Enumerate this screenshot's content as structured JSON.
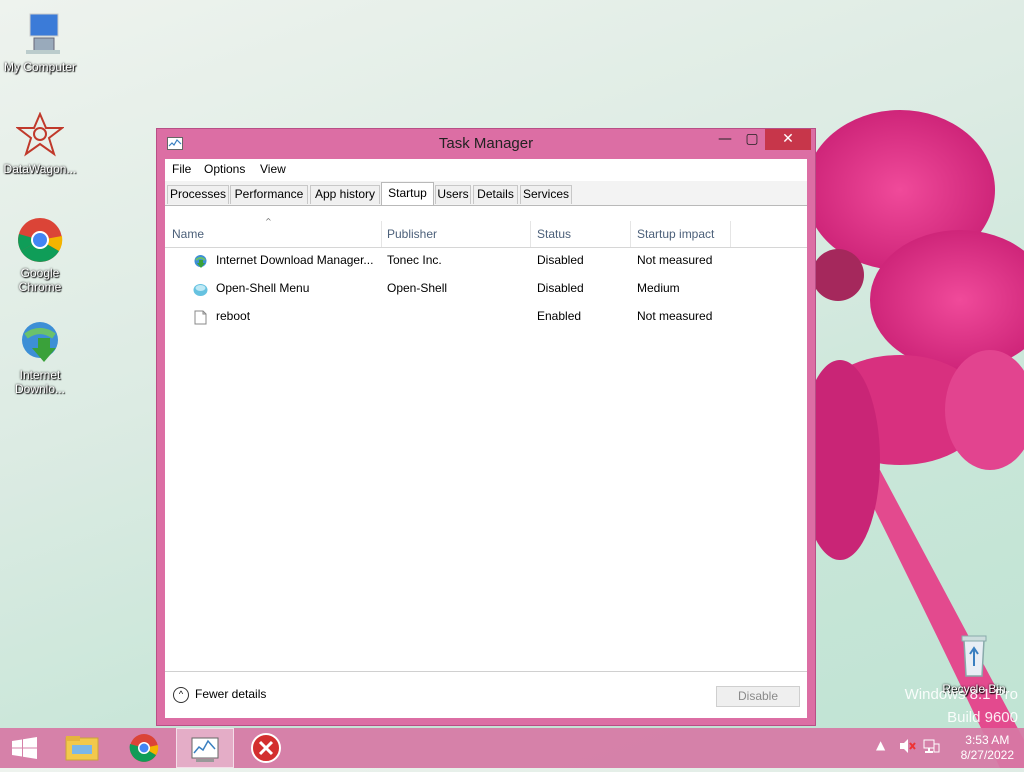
{
  "desktop": {
    "icons": [
      {
        "name": "My Computer",
        "icon": "computer-icon"
      },
      {
        "name": "DataWagon...",
        "icon": "datawagon-icon"
      },
      {
        "name": "Google Chrome",
        "icon": "chrome-icon"
      },
      {
        "name": "Internet Downlo...",
        "icon": "idm-icon"
      },
      {
        "name": "Recycle Bin",
        "icon": "recycle-bin-icon"
      }
    ],
    "watermark_line1": "Windows 8.1 Pro",
    "watermark_line2": "Build 9600"
  },
  "window": {
    "title": "Task Manager",
    "min_glyph": "—",
    "max_glyph": "▢",
    "close_glyph": "✕",
    "menu": [
      "File",
      "Options",
      "View"
    ],
    "tabs": [
      "Processes",
      "Performance",
      "App history",
      "Startup",
      "Users",
      "Details",
      "Services"
    ],
    "active_tab": "Startup",
    "columns": [
      "Name",
      "Publisher",
      "Status",
      "Startup impact"
    ],
    "sort_glyph": "^",
    "rows": [
      {
        "name": "Internet Download Manager...",
        "publisher": "Tonec Inc.",
        "status": "Disabled",
        "impact": "Not measured",
        "icon": "idm-icon"
      },
      {
        "name": "Open-Shell Menu",
        "publisher": "Open-Shell",
        "status": "Disabled",
        "impact": "Medium",
        "icon": "open-shell-icon"
      },
      {
        "name": "reboot",
        "publisher": "",
        "status": "Enabled",
        "impact": "Not measured",
        "icon": "file-icon"
      }
    ],
    "fewer_details": "Fewer details",
    "fewer_glyph": "^",
    "disable_button": "Disable"
  },
  "taskbar": {
    "items": [
      "start-icon",
      "file-explorer-icon",
      "chrome-icon",
      "task-manager-icon",
      "close-red-icon"
    ],
    "time": "3:53 AM",
    "date": "8/27/2022"
  }
}
